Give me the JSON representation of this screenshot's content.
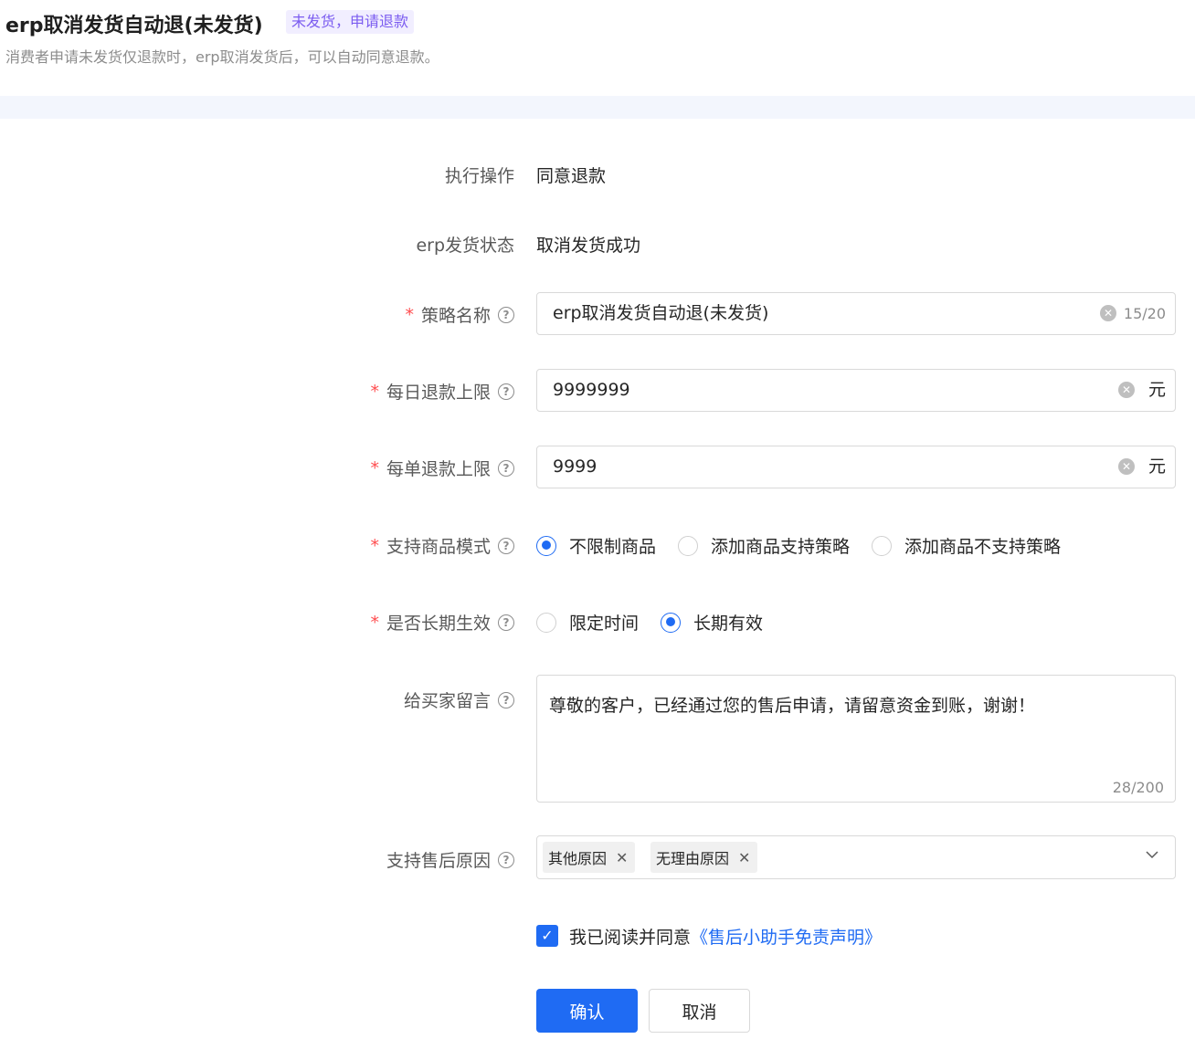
{
  "header": {
    "title": "erp取消发货自动退(未发货)",
    "badge": "未发货，申请退款",
    "subtitle": "消费者申请未发货仅退款时，erp取消发货后，可以自动同意退款。"
  },
  "form": {
    "action": {
      "label": "执行操作",
      "value": "同意退款"
    },
    "erp_status": {
      "label": "erp发货状态",
      "value": "取消发货成功"
    },
    "strategy_name": {
      "label": "策略名称",
      "value": "erp取消发货自动退(未发货)",
      "counter": "15/20"
    },
    "daily_limit": {
      "label": "每日退款上限",
      "value": "9999999",
      "suffix": "元"
    },
    "order_limit": {
      "label": "每单退款上限",
      "value": "9999",
      "suffix": "元"
    },
    "product_mode": {
      "label": "支持商品模式",
      "options": [
        "不限制商品",
        "添加商品支持策略",
        "添加商品不支持策略"
      ],
      "selected": "不限制商品"
    },
    "long_term": {
      "label": "是否长期生效",
      "options": [
        "限定时间",
        "长期有效"
      ],
      "selected": "长期有效"
    },
    "buyer_message": {
      "label": "给买家留言",
      "value": "尊敬的客户，已经通过您的售后申请，请留意资金到账，谢谢！",
      "counter": "28/200"
    },
    "reasons": {
      "label": "支持售后原因",
      "tags": [
        "其他原因",
        "无理由原因"
      ]
    },
    "agreement": {
      "text": "我已阅读并同意",
      "link": "《售后小助手免责声明》",
      "checked": true
    }
  },
  "buttons": {
    "confirm": "确认",
    "cancel": "取消"
  },
  "colors": {
    "primary": "#1f6bf3",
    "required": "#ff4d4f",
    "badge_text": "#7b5cf0",
    "badge_bg": "#f1eeff",
    "band": "#f3f6fd"
  }
}
